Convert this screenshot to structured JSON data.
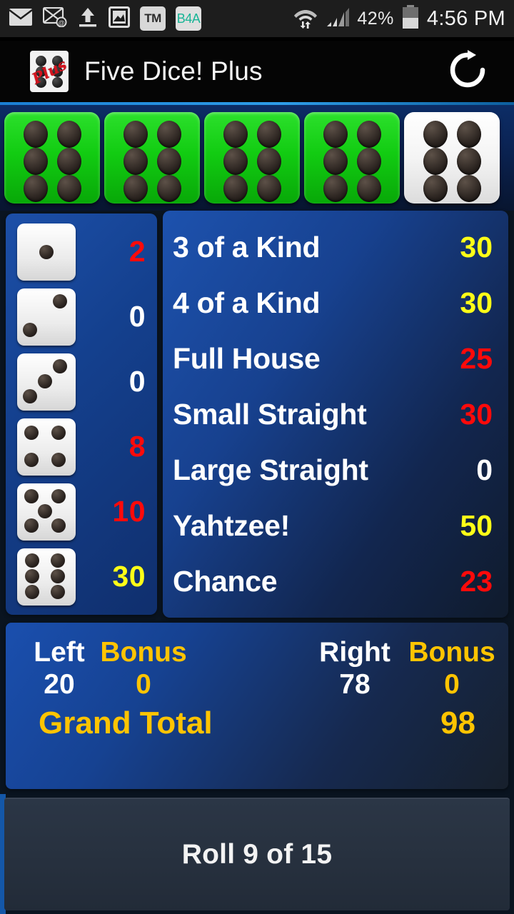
{
  "status_bar": {
    "icons": [
      "envelope-icon",
      "email-at-icon",
      "upload-icon",
      "gallery-icon"
    ],
    "tm_badge": "TM",
    "b4a_badge": "B4A",
    "wifi_icon": "wifi-transfer-icon",
    "signal_icon": "cellular-signal-icon",
    "battery_percent": "42%",
    "battery_icon": "battery-icon",
    "time": "4:56 PM"
  },
  "app_bar": {
    "icon_name": "five-dice-plus-app-icon",
    "icon_overlay_text": "Plus",
    "title": "Five Dice! Plus",
    "refresh_icon": "refresh-icon",
    "accent_color": "#2e9de8"
  },
  "dice_tray": {
    "dice": [
      {
        "value": 6,
        "held": true
      },
      {
        "value": 6,
        "held": true
      },
      {
        "value": 6,
        "held": true
      },
      {
        "value": 6,
        "held": true
      },
      {
        "value": 6,
        "held": false
      }
    ],
    "held_color": "#12cc12",
    "free_color": "#ffffff"
  },
  "upper_section": {
    "rows": [
      {
        "die": 1,
        "score": "2",
        "color": "red"
      },
      {
        "die": 2,
        "score": "0",
        "color": "white"
      },
      {
        "die": 3,
        "score": "0",
        "color": "white"
      },
      {
        "die": 4,
        "score": "8",
        "color": "red"
      },
      {
        "die": 5,
        "score": "10",
        "color": "red"
      },
      {
        "die": 6,
        "score": "30",
        "color": "yellow"
      }
    ]
  },
  "lower_section": {
    "rows": [
      {
        "label": "3 of a Kind",
        "score": "30",
        "color": "yellow"
      },
      {
        "label": "4 of a Kind",
        "score": "30",
        "color": "yellow"
      },
      {
        "label": "Full House",
        "score": "25",
        "color": "red"
      },
      {
        "label": "Small Straight",
        "score": "30",
        "color": "red"
      },
      {
        "label": "Large Straight",
        "score": "0",
        "color": "white"
      },
      {
        "label": "Yahtzee!",
        "score": "50",
        "color": "yellow"
      },
      {
        "label": "Chance",
        "score": "23",
        "color": "red"
      }
    ]
  },
  "totals": {
    "left_label": "Left",
    "left_value": "20",
    "left_bonus_label": "Bonus",
    "left_bonus_value": "0",
    "right_label": "Right",
    "right_value": "78",
    "right_bonus_label": "Bonus",
    "right_bonus_value": "0",
    "grand_total_label": "Grand Total",
    "grand_total_value": "98"
  },
  "roll_bar": {
    "text": "Roll 9 of 15"
  },
  "colors": {
    "red": "#ff0a0a",
    "yellow": "#ffff17",
    "white": "#ffffff",
    "gold": "#ffc400",
    "panel_blue": "#1c4fa8"
  }
}
